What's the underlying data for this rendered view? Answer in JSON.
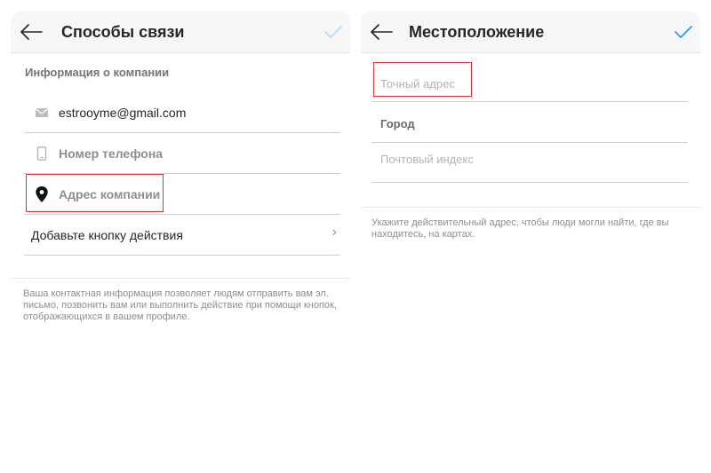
{
  "left": {
    "title": "Способы связи",
    "section_header": "Информация о компании",
    "email_value": "estrooyme@gmail.com",
    "phone_placeholder": "Номер телефона",
    "address_label": "Адрес компании",
    "action_label": "Добавьте кнопку действия",
    "chevron": "›",
    "description": "Ваша контактная информация позволяет людям отправить вам эл. письмо, позвонить вам или выполнить действие при помощи кнопок, отображающихся в вашем профиле."
  },
  "right": {
    "title": "Местоположение",
    "street_placeholder": "Точный адрес",
    "city_label": "Город",
    "zip_placeholder": "Почтовый индекс",
    "description": "Укажите действительный адрес, чтобы люди могли найти, где вы находитесь, на картах."
  },
  "colors": {
    "accent_blue": "#3897f0",
    "check_disabled": "#b9d9f7",
    "highlight_red": "#e0353b",
    "header_bg": "#f7f7f7"
  },
  "icons": [
    "back-arrow-icon",
    "checkmark-icon",
    "envelope-icon",
    "phone-icon",
    "location-pin-icon",
    "chevron-right-icon"
  ]
}
